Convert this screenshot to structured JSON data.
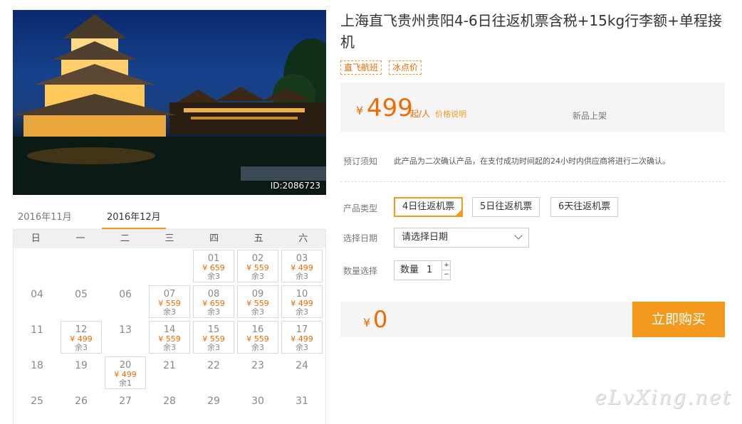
{
  "photo": {
    "id_label": "ID:2086723"
  },
  "product": {
    "title": "上海直飞贵州贵阳4-6日往返机票含税+15kg行李额+单程接机",
    "tags": [
      "直飞航班",
      "冰点价"
    ]
  },
  "price": {
    "currency": "¥",
    "amount": "499",
    "unit": "起/人",
    "note_link": "价格说明",
    "status": "新品上架"
  },
  "booking_notice": {
    "label": "预订须知",
    "text": "此产品为二次确认产品，在支付成功时间起的24小时内供应商将进行二次确认。"
  },
  "product_type": {
    "label": "产品类型",
    "options": [
      "4日往返机票",
      "5日往返机票",
      "6天往返机票"
    ],
    "selected_index": 0
  },
  "date_select": {
    "label": "选择日期",
    "placeholder": "请选择日期"
  },
  "quantity": {
    "label": "数量选择",
    "field_label": "数量",
    "value": "1",
    "plus": "+",
    "minus": "−"
  },
  "total": {
    "currency": "¥",
    "amount": "0"
  },
  "buy_button": "立即购买",
  "calendar": {
    "tabs": [
      "2016年11月",
      "2016年12月"
    ],
    "active_tab": 1,
    "weekdays": [
      "日",
      "一",
      "二",
      "三",
      "四",
      "五",
      "六"
    ],
    "rows": [
      [
        null,
        null,
        null,
        null,
        {
          "d": "01",
          "p": "¥ 659",
          "r": "余3"
        },
        {
          "d": "02",
          "p": "¥ 559",
          "r": "余3"
        },
        {
          "d": "03",
          "p": "¥ 499",
          "r": "余3"
        }
      ],
      [
        {
          "d": "04"
        },
        {
          "d": "05"
        },
        {
          "d": "06"
        },
        {
          "d": "07",
          "p": "¥ 559",
          "r": "余3"
        },
        {
          "d": "08",
          "p": "¥ 659",
          "r": "余3"
        },
        {
          "d": "09",
          "p": "¥ 559",
          "r": "余3"
        },
        {
          "d": "10",
          "p": "¥ 499",
          "r": "余3"
        }
      ],
      [
        {
          "d": "11"
        },
        {
          "d": "12",
          "p": "¥ 499",
          "r": "余3"
        },
        {
          "d": "13"
        },
        {
          "d": "14",
          "p": "¥ 559",
          "r": "余3"
        },
        {
          "d": "15",
          "p": "¥ 559",
          "r": "余3"
        },
        {
          "d": "16",
          "p": "¥ 559",
          "r": "余3"
        },
        {
          "d": "17",
          "p": "¥ 499",
          "r": "余3"
        }
      ],
      [
        {
          "d": "18"
        },
        {
          "d": "19"
        },
        {
          "d": "20",
          "p": "¥ 499",
          "r": "余1"
        },
        {
          "d": "21"
        },
        {
          "d": "22"
        },
        {
          "d": "23"
        },
        {
          "d": "24"
        }
      ],
      [
        {
          "d": "25"
        },
        {
          "d": "26"
        },
        {
          "d": "27"
        },
        {
          "d": "28"
        },
        {
          "d": "29"
        },
        {
          "d": "30"
        },
        {
          "d": "31"
        }
      ]
    ]
  },
  "watermark": "eLvXing.net",
  "colors": {
    "accent": "#f39a1e",
    "price": "#f06a00"
  }
}
